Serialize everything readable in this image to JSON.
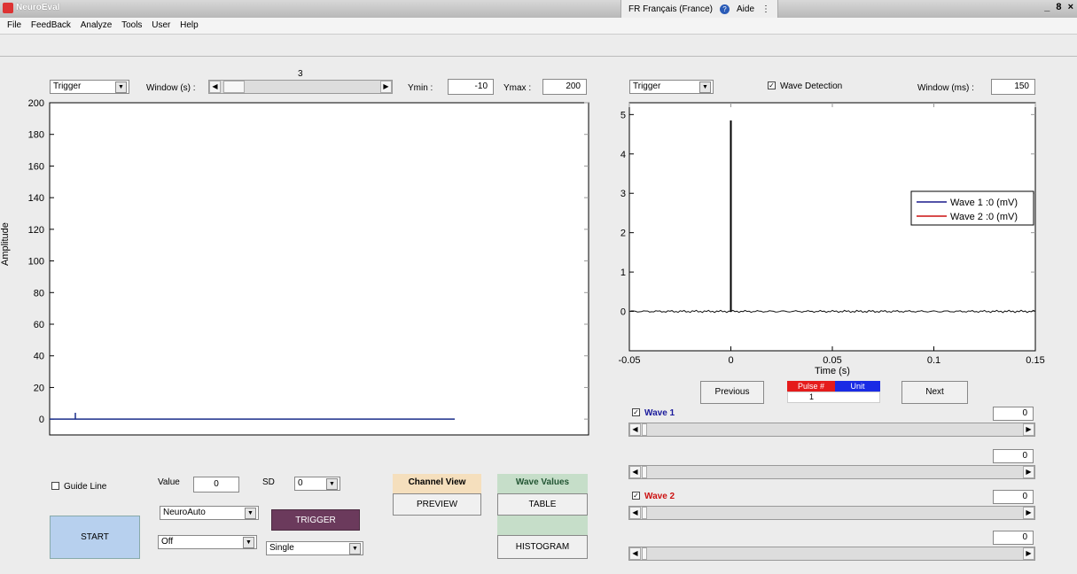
{
  "window": {
    "title": "NeuroEval",
    "language": "FR Français (France)",
    "help": "Aide",
    "controls": "_ 8 ×"
  },
  "menu": [
    "File",
    "FeedBack",
    "Analyze",
    "Tools",
    "User",
    "Help"
  ],
  "left_panel": {
    "trigger_select": "Trigger",
    "window_label": "Window (s) :",
    "window_value": "3",
    "ymin_label": "Ymin :",
    "ymin_value": "-10",
    "ymax_label": "Ymax :",
    "ymax_value": "200",
    "ylabel": "Amplitude",
    "yticks": [
      "200",
      "180",
      "160",
      "140",
      "120",
      "100",
      "80",
      "60",
      "40",
      "20",
      "0"
    ]
  },
  "right_panel": {
    "trigger_select": "Trigger",
    "wave_detection_label": "Wave Detection",
    "wave_detection_checked": true,
    "window_ms_label": "Window (ms) :",
    "window_ms_value": "150",
    "yticks": [
      "5",
      "4",
      "3",
      "2",
      "1",
      "0"
    ],
    "xticks": [
      "-0.05",
      "0",
      "0.05",
      "0.1",
      "0.15"
    ],
    "xlabel": "Time (s)",
    "legend": [
      {
        "label": "Wave 1 :0 (mV)",
        "color": "#1a1a8c"
      },
      {
        "label": "Wave 2 :0 (mV)",
        "color": "#cc1111"
      }
    ],
    "previous": "Previous",
    "next": "Next",
    "pulse_header": "Pulse #",
    "unit_header": "Unit",
    "pulse_value": "1",
    "wave1_label": "Wave 1",
    "wave1_value": "0",
    "wave1b_value": "0",
    "wave2_label": "Wave 2",
    "wave2_value": "0",
    "wave2b_value": "0"
  },
  "bottom": {
    "guide_line": "Guide Line",
    "value_label": "Value",
    "value": "0",
    "sd_label": "SD",
    "sd_value": "0",
    "mode_select": "NeuroAuto",
    "off_select": "Off",
    "trigger_button": "TRIGGER",
    "single_select": "Single",
    "start_button": "START",
    "channel_view_header": "Channel View",
    "preview_button": "PREVIEW",
    "wave_values_header": "Wave Values",
    "table_button": "TABLE",
    "histogram_button": "HISTOGRAM"
  },
  "colors": {
    "trace_left": "#1a2e8a",
    "trigger_btn": "#6b3a5c",
    "start_btn": "#b7d0ee",
    "channel_view_bg": "#f5dfbd",
    "wave_values_bg": "#c6dec9",
    "pulse_bg": "#e51b1b",
    "unit_bg": "#1a2be5"
  }
}
